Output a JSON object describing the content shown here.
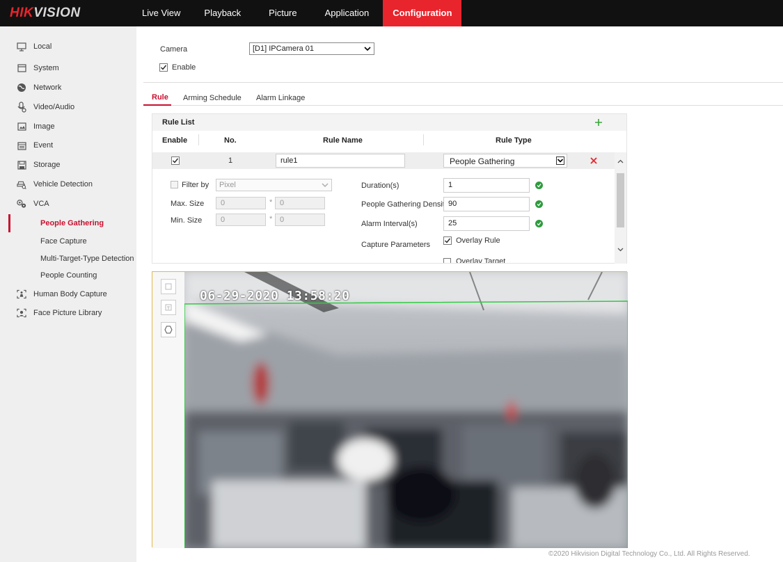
{
  "brand": {
    "logo_prefix": "HIK",
    "logo_suffix": "VISION"
  },
  "nav": [
    "Live View",
    "Playback",
    "Picture",
    "Application",
    "Configuration"
  ],
  "nav_active": "Configuration",
  "sidebar": {
    "items": [
      "Local",
      "System",
      "Network",
      "Video/Audio",
      "Image",
      "Event",
      "Storage",
      "Vehicle Detection",
      "VCA"
    ],
    "vca_sub": [
      "People Gathering",
      "Face Capture",
      "Multi-Target-Type Detection",
      "People Counting"
    ],
    "items_after": [
      "Human Body Capture",
      "Face Picture Library"
    ]
  },
  "camera": {
    "label": "Camera",
    "value": "[D1] IPCamera 01",
    "enable_label": "Enable",
    "enabled": true
  },
  "tabs": [
    "Rule",
    "Arming Schedule",
    "Alarm Linkage"
  ],
  "rule_list": {
    "title": "Rule List",
    "headers": {
      "enable": "Enable",
      "no": "No.",
      "name": "Rule Name",
      "type": "Rule Type"
    },
    "row": {
      "enabled": true,
      "no": "1",
      "name": "rule1",
      "type": "People Gathering"
    }
  },
  "params": {
    "filter_label": "Filter by",
    "filter_value": "Pixel",
    "max_label": "Max. Size",
    "min_label": "Min. Size",
    "max_w": "0",
    "max_h": "0",
    "min_w": "0",
    "min_h": "0",
    "times": "*",
    "duration_label": "Duration(s)",
    "duration_value": "1",
    "density_label": "People Gathering Density",
    "density_value": "90",
    "interval_label": "Alarm Interval(s)",
    "interval_value": "25",
    "capture_label": "Capture Parameters",
    "overlay_rule": "Overlay Rule",
    "overlay_target": "Overlay Target"
  },
  "video": {
    "timestamp": "06-29-2020 13:58:20"
  },
  "footer": "©2020 Hikvision Digital Technology Co., Ltd. All Rights Reserved.",
  "colors": {
    "accent": "#e8242c",
    "topbar": "#111111",
    "ok": "#2e9b3e",
    "add": "#3aa63a",
    "region": "#2ecc40"
  }
}
